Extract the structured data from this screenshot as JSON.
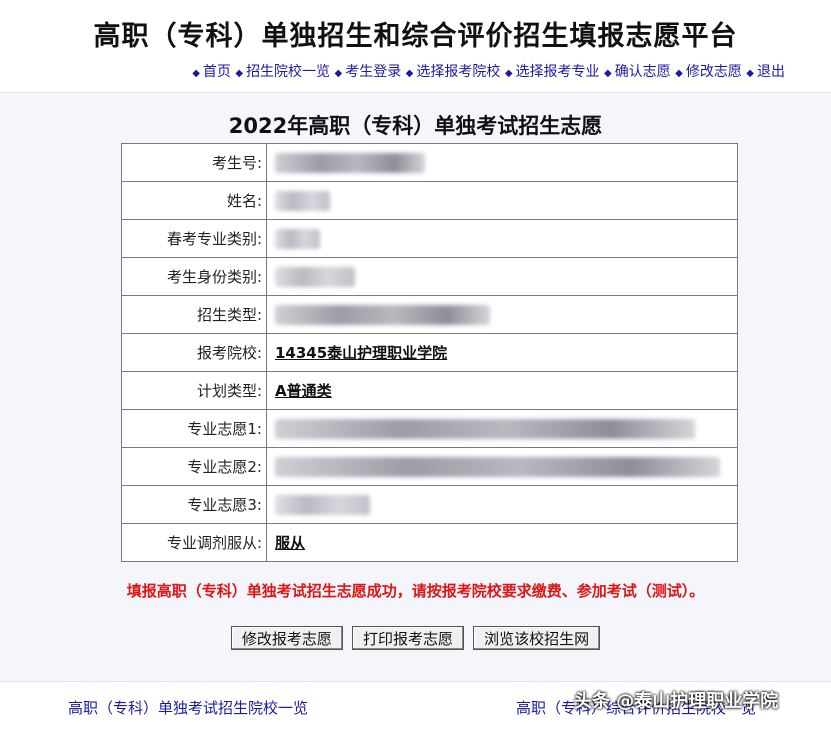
{
  "site_title": "高职（专科）单独招生和综合评价招生填报志愿平台",
  "nav": [
    "首页",
    "招生院校一览",
    "考生登录",
    "选择报考院校",
    "选择报考专业",
    "确认志愿",
    "修改志愿",
    "退出"
  ],
  "form_title": "2022年高职（专科）单独考试招生志愿",
  "rows": [
    {
      "label": "考生号:",
      "value": ""
    },
    {
      "label": "姓名:",
      "value": ""
    },
    {
      "label": "春考专业类别:",
      "value": ""
    },
    {
      "label": "考生身份类别:",
      "value": ""
    },
    {
      "label": "招生类型:",
      "value": ""
    },
    {
      "label": "报考院校:",
      "value": "14345泰山护理职业学院"
    },
    {
      "label": "计划类型:",
      "value": "A普通类"
    },
    {
      "label": "专业志愿1:",
      "value": ""
    },
    {
      "label": "专业志愿2:",
      "value": ""
    },
    {
      "label": "专业志愿3:",
      "value": ""
    },
    {
      "label": "专业调剂服从:",
      "value": "服从"
    }
  ],
  "success_message": "填报高职（专科）单独考试招生志愿成功，请按报考院校要求缴费、参加考试（测试）。",
  "buttons": {
    "modify": "修改报考志愿",
    "print": "打印报考志愿",
    "browse": "浏览该校招生网"
  },
  "footer": {
    "left": "高职（专科）单独考试招生院校一览",
    "right": "高职（专科）综合评价招生院校一览"
  },
  "watermark": "头条 @泰山护理职业学院"
}
